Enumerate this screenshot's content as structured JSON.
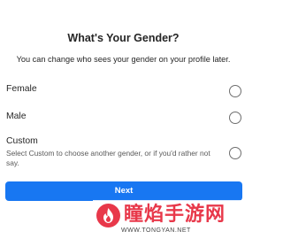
{
  "header": {
    "title": "What's Your Gender?",
    "subtitle": "You can change who sees your gender on your profile later."
  },
  "options": [
    {
      "label": "Female",
      "selected": false
    },
    {
      "label": "Male",
      "selected": false
    },
    {
      "label": "Custom",
      "description": "Select Custom to choose another gender, or if you'd rather not say.",
      "selected": false
    }
  ],
  "next_button": {
    "label": "Next"
  },
  "watermark": {
    "name": "瞳焰手游网",
    "url": "WWW.TONGYAN.NET"
  },
  "colors": {
    "accent": "#1877f2",
    "watermark": "#e8384a"
  }
}
